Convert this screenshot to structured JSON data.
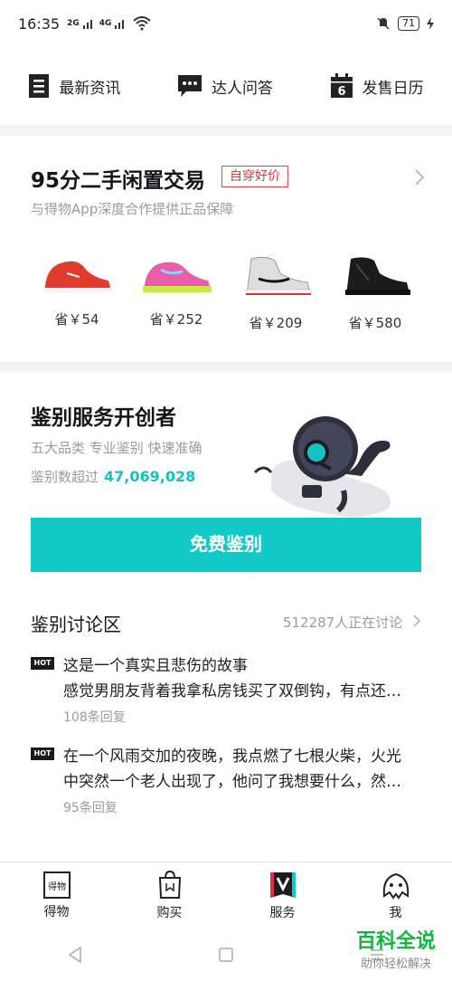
{
  "status": {
    "time": "16:35",
    "net1": "2G",
    "net2": "4G",
    "battery": "71"
  },
  "topnav": [
    {
      "label": "最新资讯"
    },
    {
      "label": "达人问答"
    },
    {
      "label": "发售日历",
      "calendar_day": "6"
    }
  ],
  "secondhand": {
    "title": "95分二手闲置交易",
    "tag": "自穿好价",
    "subtitle": "与得物App深度合作提供正品保障",
    "items": [
      {
        "save": "省￥54",
        "color": "#e23b2e"
      },
      {
        "save": "省￥252",
        "color": "#e85fa8"
      },
      {
        "save": "省￥209",
        "color": "#d8d8d8"
      },
      {
        "save": "省￥580",
        "color": "#1b1b1b"
      }
    ]
  },
  "auth": {
    "title": "鉴别服务开创者",
    "subtitle": "五大品类 专业鉴别 快速准确",
    "count_label": "鉴别数超过",
    "count_value": "47,069,028",
    "button": "免费鉴别"
  },
  "discussion": {
    "title": "鉴别讨论区",
    "count": "512287人正在讨论",
    "posts": [
      {
        "badge": "HOT",
        "line1": "这是一个真实且悲伤的故事",
        "line2": "感觉男朋友背着我拿私房钱买了双倒钩，有点还…",
        "replies": "108条回复"
      },
      {
        "badge": "HOT",
        "line1": "在一个风雨交加的夜晚，我点燃了七根火柴，火光",
        "line2": "中突然一个老人出现了，他问了我想要什么，然…",
        "replies": "95条回复"
      }
    ]
  },
  "tabs": [
    {
      "label": "得物",
      "icon_text": "得物"
    },
    {
      "label": "购买"
    },
    {
      "label": "服务"
    },
    {
      "label": "我"
    }
  ],
  "watermark": {
    "line1": "百科全说",
    "line2": "助你轻松解决"
  },
  "colors": {
    "accent": "#12c9c7",
    "tag_red": "#d23c3c",
    "watermark_green": "#17b33f"
  }
}
